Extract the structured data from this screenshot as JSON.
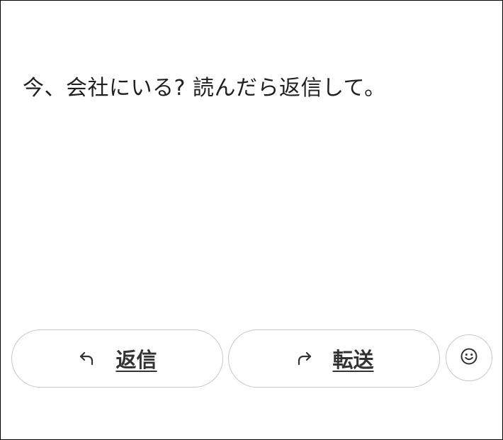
{
  "message": {
    "text": "今、会社にいる?  読んだら返信して。"
  },
  "actions": {
    "reply_label": "返信",
    "forward_label": "転送",
    "reply_icon": "reply-arrow-icon",
    "forward_icon": "forward-arrow-icon",
    "emoji_icon": "smiley-icon"
  },
  "colors": {
    "text": "#1f1f1f",
    "button_border": "#c7c7c7",
    "button_label": "#333333",
    "background": "#ffffff"
  }
}
